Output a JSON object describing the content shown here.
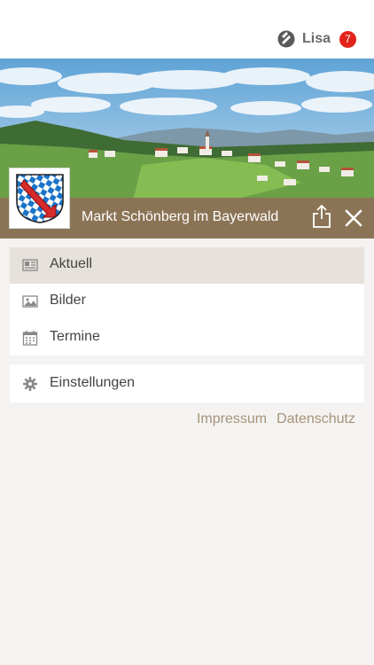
{
  "header": {
    "user_name": "Lisa",
    "notification_count": "7",
    "brand_icon": "app-logo-icon"
  },
  "place": {
    "title": "Markt Schönberg im Bayerwald",
    "share_icon": "share-icon",
    "close_icon": "close-icon"
  },
  "menu": {
    "items": [
      {
        "label": "Aktuell",
        "icon": "newspaper-icon",
        "active": true
      },
      {
        "label": "Bilder",
        "icon": "image-icon",
        "active": false
      },
      {
        "label": "Termine",
        "icon": "calendar-icon",
        "active": false
      }
    ],
    "settings": {
      "label": "Einstellungen",
      "icon": "gear-icon"
    }
  },
  "footer": {
    "impressum": "Impressum",
    "datenschutz": "Datenschutz"
  },
  "colors": {
    "title_bar": "#8b7456",
    "active_item": "#e6e1db",
    "link": "#a79379",
    "badge": "#e2231a"
  }
}
